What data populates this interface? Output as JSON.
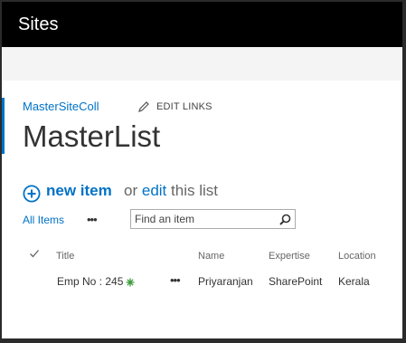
{
  "suite": {
    "title": "Sites"
  },
  "breadcrumb": {
    "site": "MasterSiteColl",
    "edit_links": "EDIT LINKS"
  },
  "page": {
    "title": "MasterList"
  },
  "commands": {
    "new_item": "new item",
    "or_text": "or",
    "edit": "edit",
    "this_list": "this list"
  },
  "views": {
    "all_items": "All Items",
    "more": "•••"
  },
  "search": {
    "placeholder": "Find an item"
  },
  "list": {
    "columns": {
      "title": "Title",
      "name": "Name",
      "expertise": "Expertise",
      "location": "Location"
    },
    "rows": [
      {
        "title": "Emp No : 245",
        "menu": "•••",
        "name": "Priyaranjan",
        "expertise": "SharePoint",
        "location": "Kerala"
      }
    ]
  },
  "colors": {
    "accent": "#0072c6",
    "suitebar": "#000000",
    "new_badge": "#3a9a3a"
  },
  "icons": {
    "edit_links": "pencil-icon",
    "new_item": "add-circle-icon",
    "search": "search-icon",
    "select_all": "checkmark-icon",
    "new": "new-badge-icon"
  }
}
